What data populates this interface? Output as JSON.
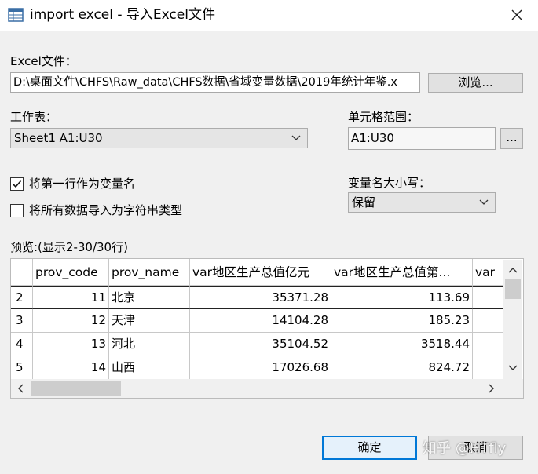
{
  "window": {
    "title": "import excel - 导入Excel文件",
    "icon": "table-icon",
    "close_icon": "close-icon"
  },
  "excel_file": {
    "label": "Excel文件：",
    "value": "D:\\桌面文件\\CHFS\\Raw_data\\CHFS数据\\省域变量数据\\2019年统计年鉴.x",
    "browse_label": "浏览..."
  },
  "worksheet": {
    "label": "工作表：",
    "selected": "Sheet1 A1:U30"
  },
  "cell_range": {
    "label": "单元格范围：",
    "value": "A1:U30",
    "ellipsis_label": "..."
  },
  "options": {
    "first_row_varnames": {
      "label": "将第一行作为变量名",
      "checked": true
    },
    "import_as_string": {
      "label": "将所有数据导入为字符串类型",
      "checked": false
    }
  },
  "varname_case": {
    "label": "变量名大小写：",
    "selected": "保留"
  },
  "preview": {
    "label": "预览:(显示2-30/30行)",
    "columns": [
      "prov_code",
      "prov_name",
      "var地区生产总值亿元",
      "var地区生产总值第...",
      "var"
    ],
    "rows": [
      {
        "num": "2",
        "cells": [
          "11",
          "北京",
          "35371.28",
          "113.69"
        ]
      },
      {
        "num": "3",
        "cells": [
          "12",
          "天津",
          "14104.28",
          "185.23"
        ]
      },
      {
        "num": "4",
        "cells": [
          "13",
          "河北",
          "35104.52",
          "3518.44"
        ]
      },
      {
        "num": "5",
        "cells": [
          "14",
          "山西",
          "17026.68",
          "824.72"
        ]
      }
    ]
  },
  "buttons": {
    "ok": "确定",
    "cancel": "取消"
  },
  "watermark": "知乎 @HTfly"
}
